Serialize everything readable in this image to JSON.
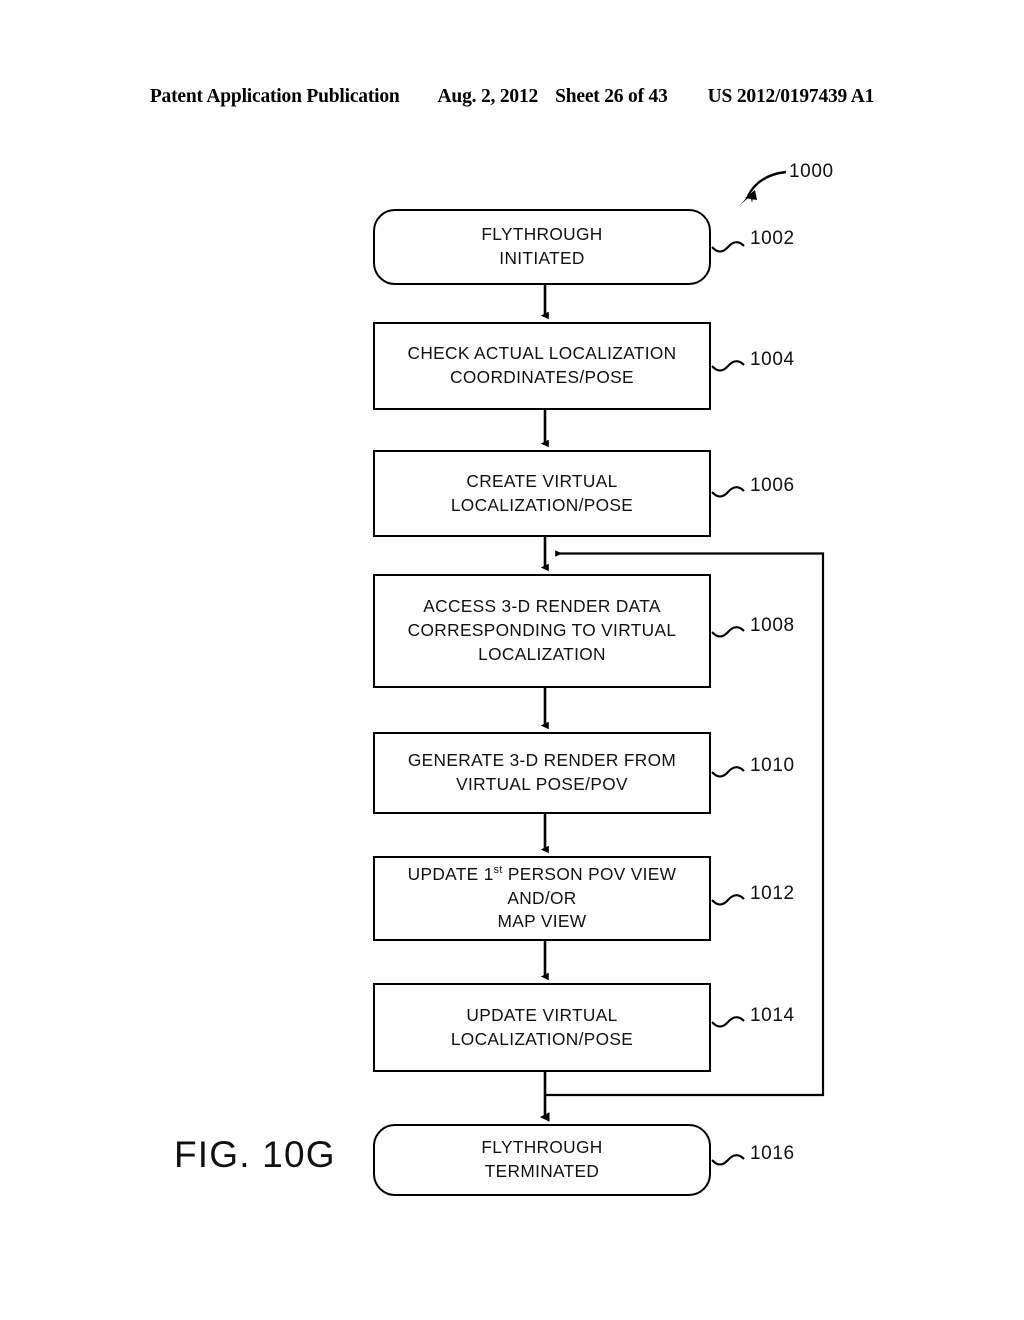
{
  "header": {
    "publication": "Patent Application Publication",
    "date": "Aug. 2, 2012",
    "sheet": "Sheet 26 of 43",
    "patent_number": "US 2012/0197439 A1"
  },
  "figure": {
    "caption": "FIG. 10G",
    "overall_ref": "1000",
    "type": "flowchart",
    "nodes": [
      {
        "ref": "1002",
        "shape": "rounded-terminal",
        "lines": [
          "FLYTHROUGH",
          "INITIATED"
        ],
        "text": "FLYTHROUGH INITIATED"
      },
      {
        "ref": "1004",
        "shape": "rectangle",
        "lines": [
          "CHECK ACTUAL LOCALIZATION",
          "COORDINATES/POSE"
        ],
        "text": "CHECK ACTUAL LOCALIZATION COORDINATES/POSE"
      },
      {
        "ref": "1006",
        "shape": "rectangle",
        "lines": [
          "CREATE VIRTUAL",
          "LOCALIZATION/POSE"
        ],
        "text": "CREATE VIRTUAL LOCALIZATION/POSE"
      },
      {
        "ref": "1008",
        "shape": "rectangle",
        "lines": [
          "ACCESS 3-D RENDER DATA",
          "CORRESPONDING TO VIRTUAL",
          "LOCALIZATION"
        ],
        "text": "ACCESS 3-D RENDER DATA CORRESPONDING TO VIRTUAL LOCALIZATION"
      },
      {
        "ref": "1010",
        "shape": "rectangle",
        "lines": [
          "GENERATE 3-D RENDER FROM",
          "VIRTUAL POSE/POV"
        ],
        "text": "GENERATE 3-D RENDER FROM VIRTUAL POSE/POV"
      },
      {
        "ref": "1012",
        "shape": "rectangle",
        "lines": [
          "UPDATE 1st PERSON POV VIEW",
          "AND/OR",
          "MAP VIEW"
        ],
        "text": "UPDATE 1st PERSON POV VIEW AND/OR MAP VIEW",
        "superscript_line": 0,
        "superscript_prefix": "UPDATE 1",
        "superscript_text": "st",
        "superscript_suffix": " PERSON POV VIEW"
      },
      {
        "ref": "1014",
        "shape": "rectangle",
        "lines": [
          "UPDATE VIRTUAL",
          "LOCALIZATION/POSE"
        ],
        "text": "UPDATE VIRTUAL LOCALIZATION/POSE"
      },
      {
        "ref": "1016",
        "shape": "rounded-terminal",
        "lines": [
          "FLYTHROUGH",
          "TERMINATED"
        ],
        "text": "FLYTHROUGH TERMINATED"
      }
    ],
    "connectors": [
      {
        "from": "1002",
        "to": "1004",
        "style": "solid-arrow"
      },
      {
        "from": "1004",
        "to": "1006",
        "style": "solid-arrow"
      },
      {
        "from": "1006",
        "to": "1008",
        "style": "solid-arrow"
      },
      {
        "from": "1008",
        "to": "1010",
        "style": "solid-arrow"
      },
      {
        "from": "1010",
        "to": "1012",
        "style": "solid-arrow"
      },
      {
        "from": "1012",
        "to": "1014",
        "style": "solid-arrow"
      },
      {
        "from": "1014",
        "to": "1016",
        "style": "solid-arrow"
      },
      {
        "from": "1014",
        "to": "1008",
        "style": "feedback-loop-right"
      }
    ],
    "colors": {
      "line": "#000000",
      "fill": "#ffffff",
      "text": "#111111"
    }
  }
}
